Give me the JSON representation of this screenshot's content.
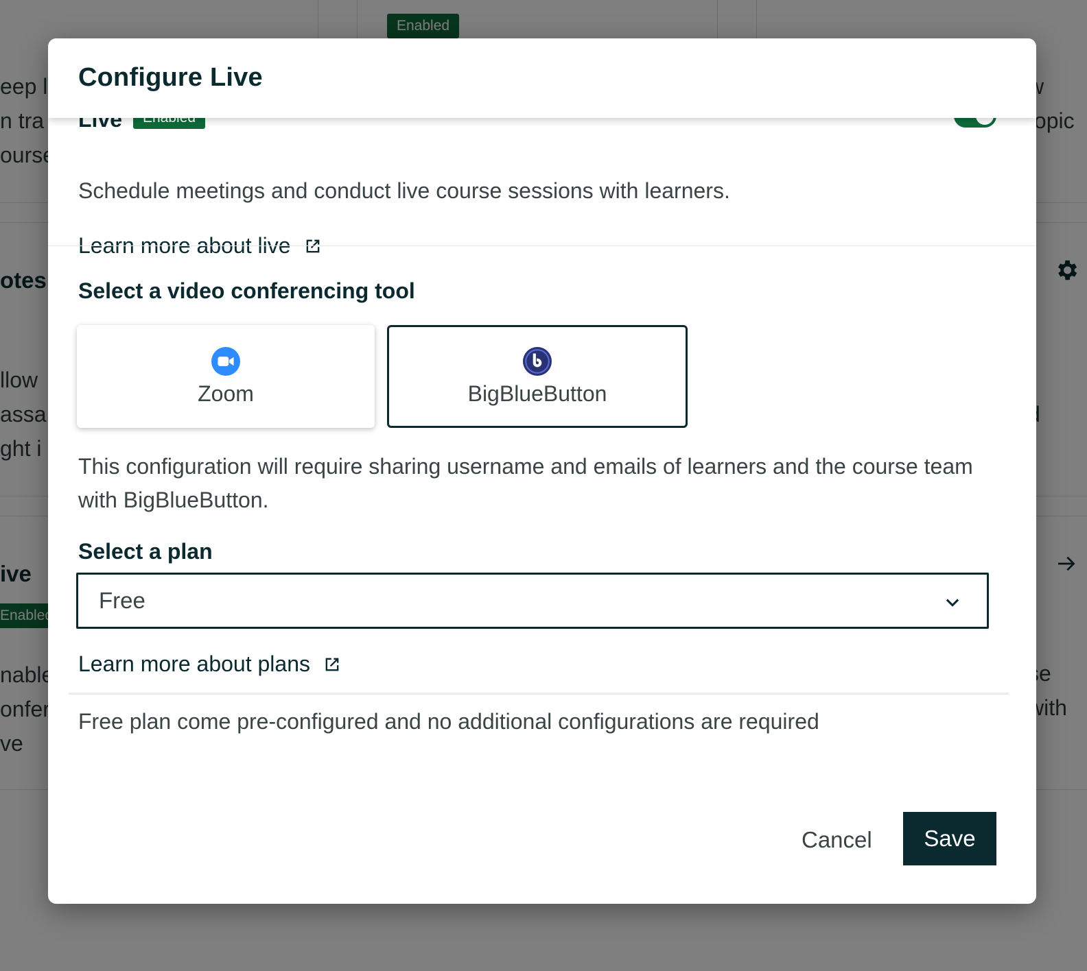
{
  "modal": {
    "title": "Configure Live",
    "peek_title": "Live",
    "peek_badge": "Enabled",
    "description": "Schedule meetings and conduct live course sessions with learners.",
    "learn_more_live": "Learn more about live",
    "tool_heading": "Select a video conferencing tool",
    "tools": [
      {
        "label": "Zoom",
        "selected": false
      },
      {
        "label": "BigBlueButton",
        "selected": true
      }
    ],
    "config_note": "This configuration will require sharing username and emails of learners and the course team with BigBlueButton.",
    "plan_heading": "Select a plan",
    "plan_value": "Free",
    "learn_more_plans": "Learn more about plans",
    "plan_note": "Free plan come pre-configured and no additional configurations are required",
    "cancel_label": "Cancel",
    "save_label": "Save"
  },
  "background": {
    "badge_top": "Enabled",
    "badge_left": "Enabled",
    "left_fragments": [
      "eep l",
      "n tra",
      "ourse",
      "otes",
      "llow",
      "assa",
      "ght i",
      "ive",
      "nable",
      "onfer",
      "ve"
    ],
    "right_fragments": [
      "w",
      "topic",
      "d",
      "se",
      "with"
    ]
  },
  "colors": {
    "primary": "#0a2a30",
    "success": "#0e6b3a",
    "zoom_blue": "#2d8cff",
    "bbb_navy": "#283274"
  }
}
